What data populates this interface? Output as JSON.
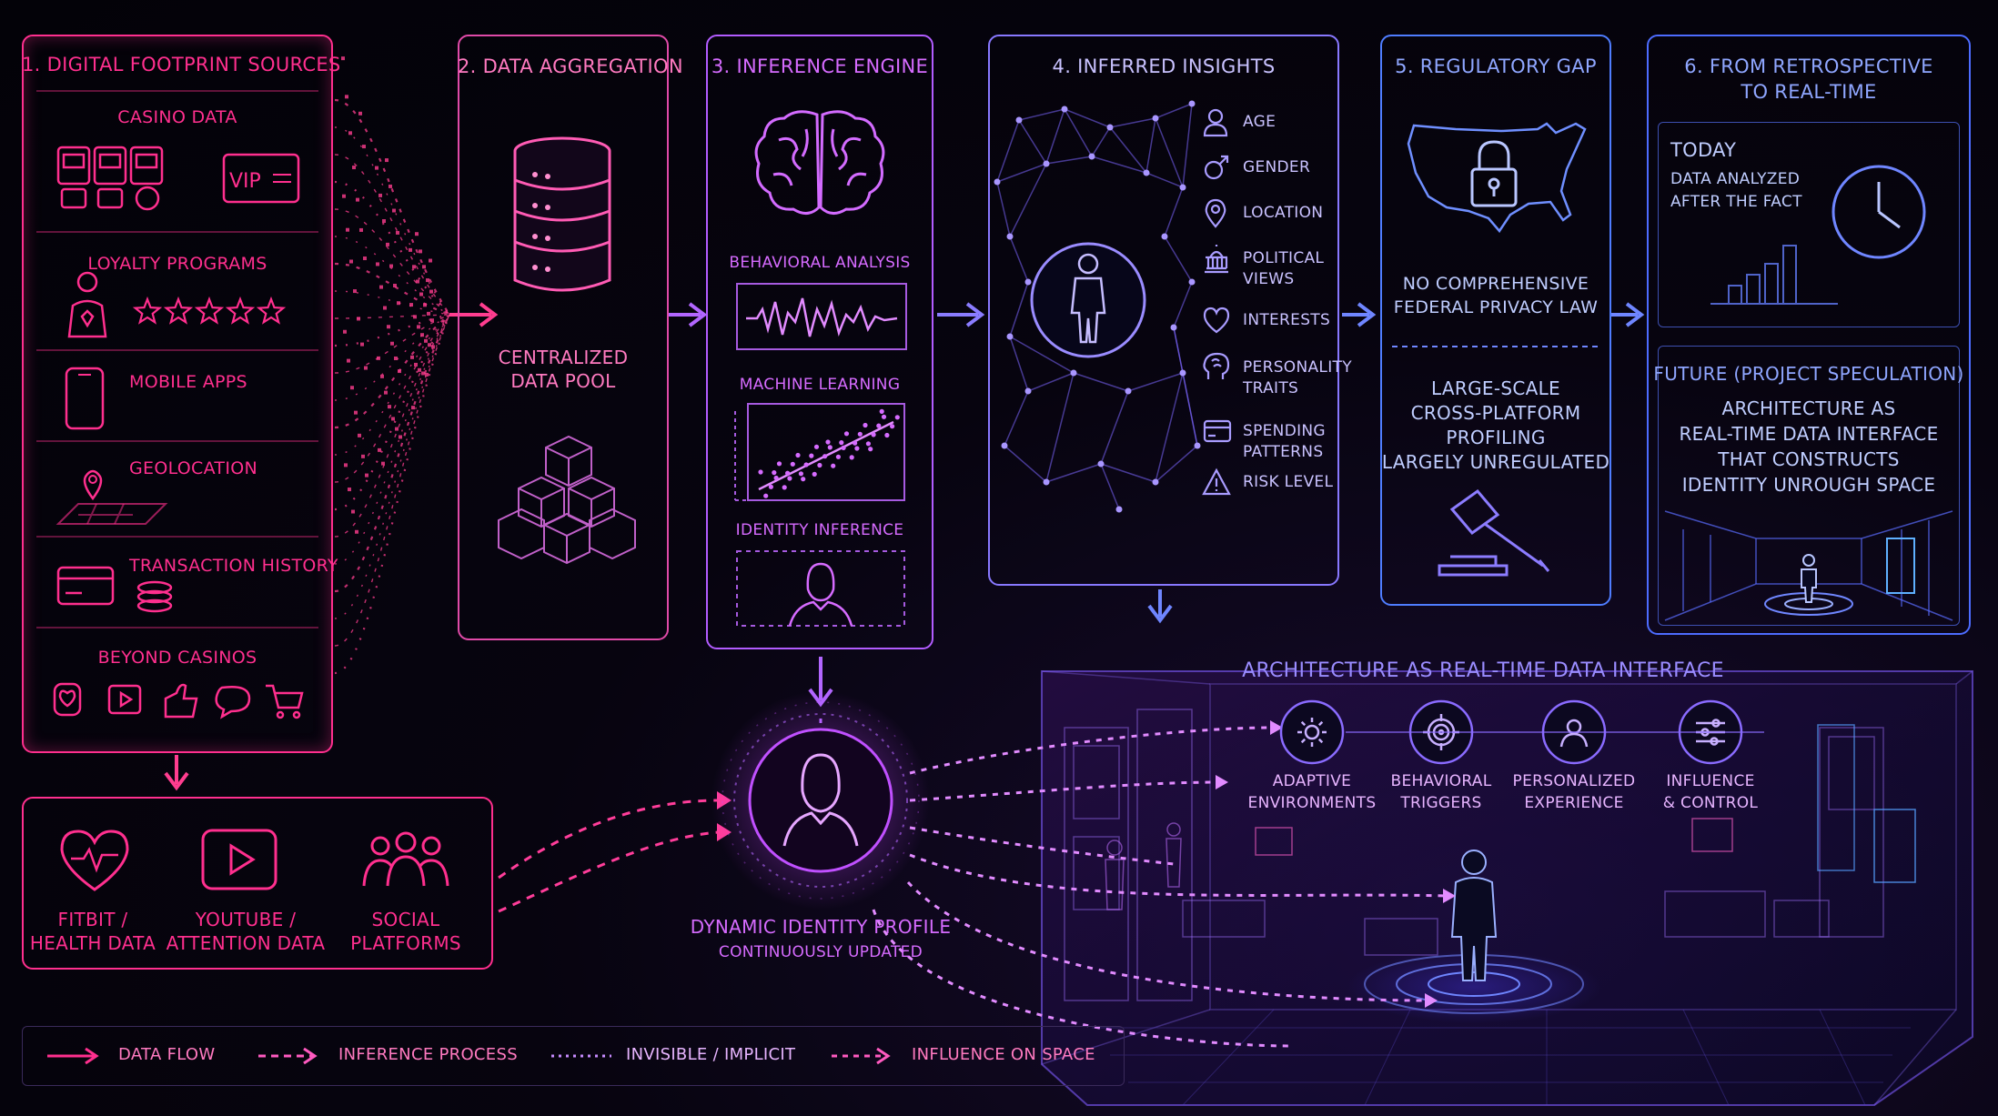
{
  "colors": {
    "pink": "#ff2f8e",
    "magenta": "#d66bff",
    "violet": "#a45cff",
    "blue": "#6f86ff",
    "background": "#05030a"
  },
  "panel1": {
    "title": "1. DIGITAL FOOTPRINT SOURCES",
    "casino": {
      "label": "CASINO DATA",
      "vip": "VIP"
    },
    "loyalty": "LOYALTY PROGRAMS",
    "mobile": "MOBILE APPS",
    "geo": "GEOLOCATION",
    "transactions": "TRANSACTION HISTORY",
    "beyond": "BEYOND CASINOS"
  },
  "panel2": {
    "title": "2. DATA AGGREGATION",
    "pool_line1": "CENTRALIZED",
    "pool_line2": "DATA POOL"
  },
  "panel3": {
    "title": "3. INFERENCE ENGINE",
    "behavioral": "BEHAVIORAL ANALYSIS",
    "ml": "MACHINE LEARNING",
    "identity": "IDENTITY INFERENCE"
  },
  "panel4": {
    "title": "4. INFERRED INSIGHTS",
    "items": [
      {
        "line1": "AGE",
        "line2": "",
        "icon": "person-icon"
      },
      {
        "line1": "GENDER",
        "line2": "",
        "icon": "gender-icon"
      },
      {
        "line1": "LOCATION",
        "line2": "",
        "icon": "location-pin-icon"
      },
      {
        "line1": "POLITICAL",
        "line2": "VIEWS",
        "icon": "capitol-building-icon"
      },
      {
        "line1": "INTERESTS",
        "line2": "",
        "icon": "heart-icon"
      },
      {
        "line1": "PERSONALITY",
        "line2": "TRAITS",
        "icon": "brain-head-icon"
      },
      {
        "line1": "SPENDING",
        "line2": "PATTERNS",
        "icon": "credit-card-icon"
      },
      {
        "line1": "RISK LEVEL",
        "line2": "",
        "icon": "warning-icon"
      }
    ]
  },
  "panel5": {
    "title": "5. REGULATORY GAP",
    "law_line1": "NO COMPREHENSIVE",
    "law_line2": "FEDERAL PRIVACY LAW",
    "prof_line1": "LARGE-SCALE",
    "prof_line2": "CROSS-PLATFORM",
    "prof_line3": "PROFILING",
    "prof_line4": "LARGELY UNREGULATED"
  },
  "panel6": {
    "title_line1": "6. FROM RETROSPECTIVE",
    "title_line2": "TO REAL-TIME",
    "today": "TODAY",
    "today_desc_line1": "DATA ANALYZED",
    "today_desc_line2": "AFTER THE FACT",
    "future_title": "FUTURE (PROJECT SPECULATION)",
    "future_line1": "ARCHITECTURE AS",
    "future_line2": "REAL-TIME DATA INTERFACE",
    "future_line3": "THAT CONSTRUCTS",
    "future_line4": "IDENTITY UNROUGH SPACE"
  },
  "external": {
    "fitbit_line1": "FITBIT /",
    "fitbit_line2": "HEALTH DATA",
    "youtube_line1": "YOUTUBE /",
    "youtube_line2": "ATTENTION DATA",
    "social_line1": "SOCIAL",
    "social_line2": "PLATFORMS"
  },
  "profile": {
    "line1": "DYNAMIC IDENTITY PROFILE",
    "line2": "CONTINUOUSLY UPDATED"
  },
  "architecture": {
    "title": "ARCHITECTURE AS REAL-TIME DATA INTERFACE",
    "items": [
      {
        "line1": "ADAPTIVE",
        "line2": "ENVIRONMENTS",
        "icon": "sun-settings-icon"
      },
      {
        "line1": "BEHAVIORAL",
        "line2": "TRIGGERS",
        "icon": "target-icon"
      },
      {
        "line1": "PERSONALIZED",
        "line2": "EXPERIENCE",
        "icon": "person-circle-icon"
      },
      {
        "line1": "INFLUENCE",
        "line2": "& CONTROL",
        "icon": "sliders-icon"
      }
    ]
  },
  "legend": {
    "data_flow": "DATA FLOW",
    "inference": "INFERENCE PROCESS",
    "invisible": "INVISIBLE / IMPLICIT",
    "influence": "INFLUENCE ON SPACE"
  }
}
